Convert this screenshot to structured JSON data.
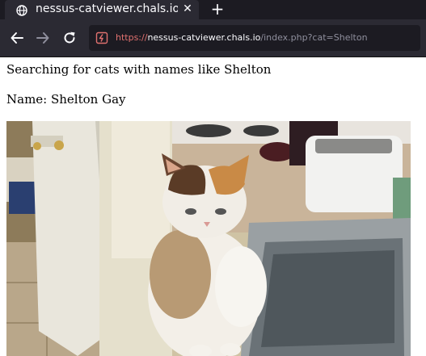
{
  "browser": {
    "tab": {
      "title": "nessus-catviewer.chals.io",
      "close_glyph": "✕"
    },
    "new_tab_glyph": "+",
    "address_bar": {
      "scheme": "https://",
      "host": "nessus-catviewer.chals.io",
      "path": "/index.php?cat=Shelton"
    },
    "icons": {
      "favicon": "globe-icon",
      "back": "arrow-left-icon",
      "forward": "arrow-right-icon",
      "reload": "reload-icon",
      "url_security": "insecure-lock-icon"
    }
  },
  "page": {
    "search_message": "Searching for cats with names like Shelton",
    "name_line": "Name: Shelton Gay",
    "photo": {
      "subject": "calico cat sitting on a kitchen sink"
    }
  },
  "colors": {
    "tabbar_bg": "#1c1b22",
    "toolbar_bg": "#2b2a33",
    "url_scheme": "#e0716f",
    "security_icon": "#e0716f"
  }
}
